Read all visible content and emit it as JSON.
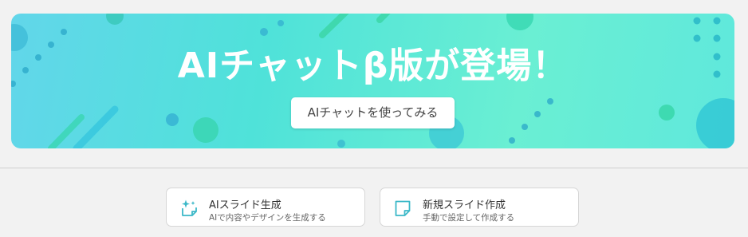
{
  "banner": {
    "title": "AIチャットβ版が登場！",
    "cta_label": "AIチャットを使ってみる"
  },
  "actions": [
    {
      "title": "AIスライド生成",
      "subtitle": "AIで内容やデザインを生成する",
      "icon": "ai-sparkle-slide-icon"
    },
    {
      "title": "新規スライド作成",
      "subtitle": "手動で設定して作成する",
      "icon": "blank-slide-icon"
    }
  ],
  "colors": {
    "banner_gradient_start": "#62d6ea",
    "banner_gradient_end": "#5fe8dc",
    "icon_accent": "#3bb8c8",
    "page_background": "#f2f2f2"
  }
}
